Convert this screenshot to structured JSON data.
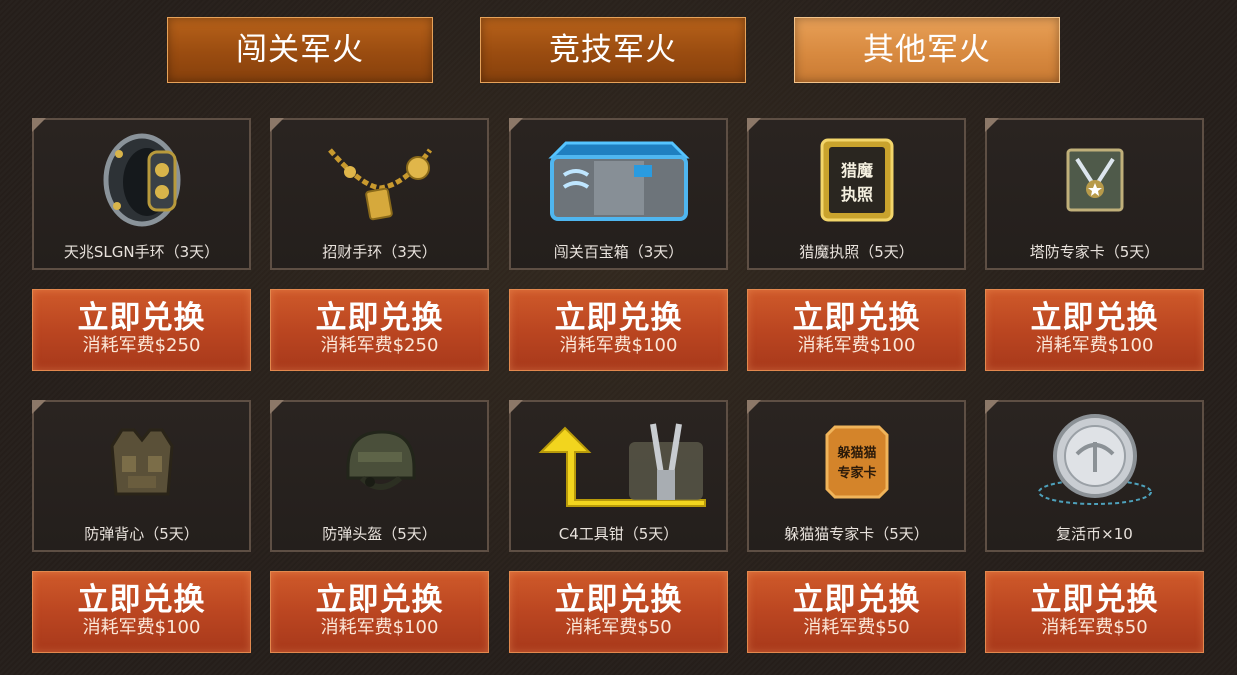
{
  "tabs": [
    {
      "label": "闯关军火"
    },
    {
      "label": "竞技军火"
    },
    {
      "label": "其他军火"
    }
  ],
  "items": [
    {
      "name": "天兆SLGN手环（3天）",
      "icon": "bracelet-icon",
      "action": "立即兑换",
      "cost": "消耗军费$250"
    },
    {
      "name": "招财手环（3天）",
      "icon": "gold-bracelet-icon",
      "action": "立即兑换",
      "cost": "消耗军费$250"
    },
    {
      "name": "闯关百宝箱（3天）",
      "icon": "treasure-box-icon",
      "action": "立即兑换",
      "cost": "消耗军费$100"
    },
    {
      "name": "猎魔执照（5天）",
      "icon": "license-card-icon",
      "badge_text": "猎魔执照",
      "action": "立即兑换",
      "cost": "消耗军费$100"
    },
    {
      "name": "塔防专家卡（5天）",
      "icon": "tower-defense-card-icon",
      "action": "立即兑换",
      "cost": "消耗军费$100"
    },
    {
      "name": "防弹背心（5天）",
      "icon": "vest-icon",
      "action": "立即兑换",
      "cost": "消耗军费$100"
    },
    {
      "name": "防弹头盔（5天）",
      "icon": "helmet-icon",
      "action": "立即兑换",
      "cost": "消耗军费$100"
    },
    {
      "name": "C4工具钳（5天）",
      "icon": "pliers-icon",
      "action": "立即兑换",
      "cost": "消耗军费$50"
    },
    {
      "name": "躲猫猫专家卡（5天）",
      "icon": "hide-seek-card-icon",
      "badge_text": "躲猫猫专家卡",
      "action": "立即兑换",
      "cost": "消耗军费$50"
    },
    {
      "name": "复活币×10",
      "icon": "revive-coin-icon",
      "action": "立即兑换",
      "cost": "消耗军费$50"
    }
  ],
  "colors": {
    "button": "#bb4621",
    "tab": "#9a4c10",
    "tab_active": "#d88a40",
    "card_border": "#5e4f44"
  }
}
